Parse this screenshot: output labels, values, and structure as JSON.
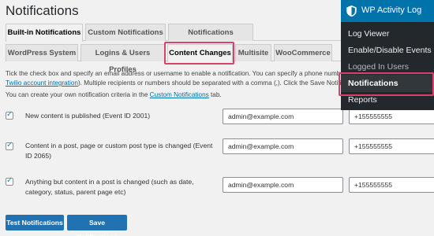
{
  "page": {
    "title": "Notifications"
  },
  "tabs_primary": [
    "Built-in Notifications",
    "Custom Notifications",
    "Notifications Templates"
  ],
  "tabs_secondary": [
    "WordPress System",
    "Logins & Users Profiles",
    "Content Changes",
    "Multisite",
    "WooCommerce"
  ],
  "description": {
    "line1": "Tick the check box and specify an email address or username to enable a notification. You can specify a phone number",
    "line2_link": "Twilio account integration",
    "line2_rest": "). Multiple recipients or numbers should be separated with a comma (,). Click the Save Notific",
    "line3_pre": "You can create your own notification criteria in the ",
    "line3_link": "Custom Notifications",
    "line3_post": " tab."
  },
  "notifications": [
    {
      "label": "New content is published (Event ID 2001)",
      "checked": true,
      "email": "admin@example.com",
      "phone": "+155555555"
    },
    {
      "label_line1": "Content in a post, page or custom post type is changed (Event",
      "label_line2": "ID 2065)",
      "checked": true,
      "email": "admin@example.com",
      "phone": "+155555555"
    },
    {
      "label_line1": "Anything but content in a post is changed (such as date,",
      "label_line2": "category, status, parent page etc)",
      "checked": true,
      "email": "admin@example.com",
      "phone": "+155555555"
    }
  ],
  "buttons": {
    "test": "Test Notifications",
    "save": "Save Notifications"
  },
  "admin_menu": {
    "title": "WP Activity Log",
    "items": [
      "Log Viewer",
      "Enable/Disable Events",
      "Logged In Users",
      "Notifications",
      "Reports"
    ],
    "current": "Notifications"
  },
  "colors": {
    "highlight": "#d6426b",
    "link": "#0073aa",
    "button": "#2271b1",
    "menu_bg": "#23282d",
    "menu_head": "#0073aa"
  }
}
